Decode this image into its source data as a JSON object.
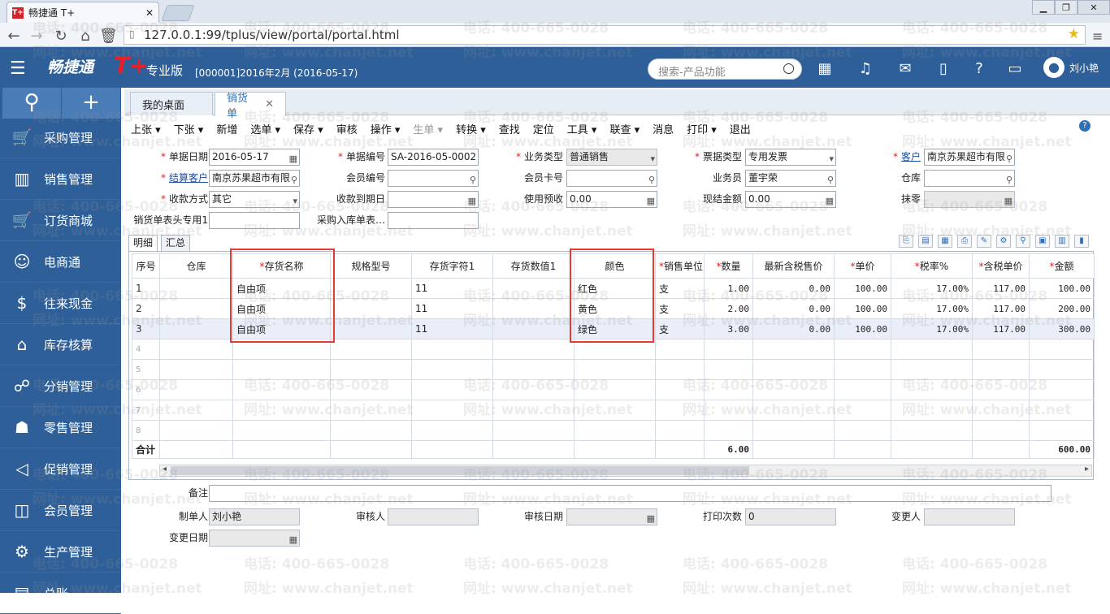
{
  "browser": {
    "tab_title": "畅捷通 T+",
    "favicon_text": "T+",
    "url": "127.0.0.1:99/tplus/view/portal/portal.html",
    "win_controls": [
      "▁",
      "❐",
      "✕"
    ]
  },
  "header": {
    "logo_text": "畅捷通",
    "logo_mark": "T+",
    "edition": "专业版",
    "period": "[000001]2016年2月   (2016-05-17)",
    "search_placeholder": "搜索-产品功能",
    "user": "刘小艳"
  },
  "sidebar": {
    "items": [
      {
        "label": "采购管理",
        "icon": "cart-icon"
      },
      {
        "label": "销售管理",
        "icon": "bar-chart-icon"
      },
      {
        "label": "订货商城",
        "icon": "shopping-cart-icon"
      },
      {
        "label": "电商通",
        "icon": "people-icon"
      },
      {
        "label": "往来现金",
        "icon": "dollar-icon"
      },
      {
        "label": "库存核算",
        "icon": "warehouse-icon"
      },
      {
        "label": "分销管理",
        "icon": "distribution-icon"
      },
      {
        "label": "零售管理",
        "icon": "retail-icon"
      },
      {
        "label": "促销管理",
        "icon": "megaphone-icon"
      },
      {
        "label": "会员管理",
        "icon": "member-icon"
      },
      {
        "label": "生产管理",
        "icon": "gears-icon"
      },
      {
        "label": "总账",
        "icon": "ledger-icon"
      }
    ]
  },
  "tabs": [
    {
      "label": "我的桌面"
    },
    {
      "label": "销货单"
    }
  ],
  "toolbar": [
    "上张 ▾",
    "下张 ▾",
    "新增",
    "选单 ▾",
    "保存 ▾",
    "审核",
    "操作 ▾",
    "生单 ▾",
    "转换 ▾",
    "查找",
    "定位",
    "工具 ▾",
    "联查 ▾",
    "消息",
    "打印 ▾",
    "退出"
  ],
  "form": {
    "doc_date_label": "单据日期",
    "doc_date": "2016-05-17",
    "doc_no_label": "单据编号",
    "doc_no": "SA-2016-05-0002",
    "biz_type_label": "业务类型",
    "biz_type": "普通销售",
    "invoice_type_label": "票据类型",
    "invoice_type": "专用发票",
    "customer_label": "客户",
    "customer": "南京苏果超市有限",
    "settle_customer_label": "结算客户",
    "settle_customer": "南京苏果超市有限",
    "member_no_label": "会员编号",
    "member_no": "",
    "member_card_label": "会员卡号",
    "member_card": "",
    "salesperson_label": "业务员",
    "salesperson": "董宇荣",
    "warehouse_label": "仓库",
    "warehouse": "",
    "pay_method_label": "收款方式",
    "pay_method": "其它",
    "due_date_label": "收款到期日",
    "due_date": "",
    "prepay_label": "使用预收",
    "prepay": "0.00",
    "cash_label": "现结金额",
    "cash": "0.00",
    "erase_label": "抹零",
    "erase": "",
    "header_special_label": "销货单表头专用1",
    "header_special": "",
    "purchase_in_label": "采购入库单表…",
    "purchase_in": ""
  },
  "detail_tabs": [
    "明细",
    "汇总"
  ],
  "grid": {
    "columns": [
      "序号",
      "仓库",
      "*存货名称",
      "规格型号",
      "存货字符1",
      "存货数值1",
      "颜色",
      "*销售单位",
      "*数量",
      "最新含税售价",
      "*单价",
      "*税率%",
      "*含税单价",
      "*金额"
    ],
    "rows": [
      [
        "1",
        "",
        "自由项",
        "",
        "11",
        "",
        "红色",
        "支",
        "1.00",
        "0.00",
        "100.00",
        "17.00%",
        "117.00",
        "100.00"
      ],
      [
        "2",
        "",
        "自由项",
        "",
        "11",
        "",
        "黄色",
        "支",
        "2.00",
        "0.00",
        "100.00",
        "17.00%",
        "117.00",
        "200.00"
      ],
      [
        "3",
        "",
        "自由项",
        "",
        "11",
        "",
        "绿色",
        "支",
        "3.00",
        "0.00",
        "100.00",
        "17.00%",
        "117.00",
        "300.00"
      ],
      [
        "4",
        "",
        "",
        "",
        "",
        "",
        "",
        "",
        "",
        "",
        "",
        "",
        "",
        ""
      ],
      [
        "5",
        "",
        "",
        "",
        "",
        "",
        "",
        "",
        "",
        "",
        "",
        "",
        "",
        ""
      ],
      [
        "6",
        "",
        "",
        "",
        "",
        "",
        "",
        "",
        "",
        "",
        "",
        "",
        "",
        ""
      ],
      [
        "7",
        "",
        "",
        "",
        "",
        "",
        "",
        "",
        "",
        "",
        "",
        "",
        "",
        ""
      ],
      [
        "8",
        "",
        "",
        "",
        "",
        "",
        "",
        "",
        "",
        "",
        "",
        "",
        "",
        ""
      ]
    ],
    "total": [
      "合计",
      "",
      "",
      "",
      "",
      "",
      "",
      "",
      "6.00",
      "",
      "",
      "",
      "",
      "600.00"
    ]
  },
  "footer": {
    "remark_label": "备注",
    "remark": "",
    "maker_label": "制单人",
    "maker": "刘小艳",
    "auditor_label": "审核人",
    "auditor": "",
    "audit_date_label": "审核日期",
    "audit_date": "",
    "print_count_label": "打印次数",
    "print_count": "0",
    "modifier_label": "变更人",
    "modifier": "",
    "modify_date_label": "变更日期",
    "modify_date": ""
  },
  "watermark": {
    "phone": "电话: 400-665-0028",
    "site": "网址: www.chanjet.net"
  },
  "colors": {
    "header": "#2e5f99",
    "sidebar": "#2e5f99",
    "highlight": "#e53935"
  }
}
